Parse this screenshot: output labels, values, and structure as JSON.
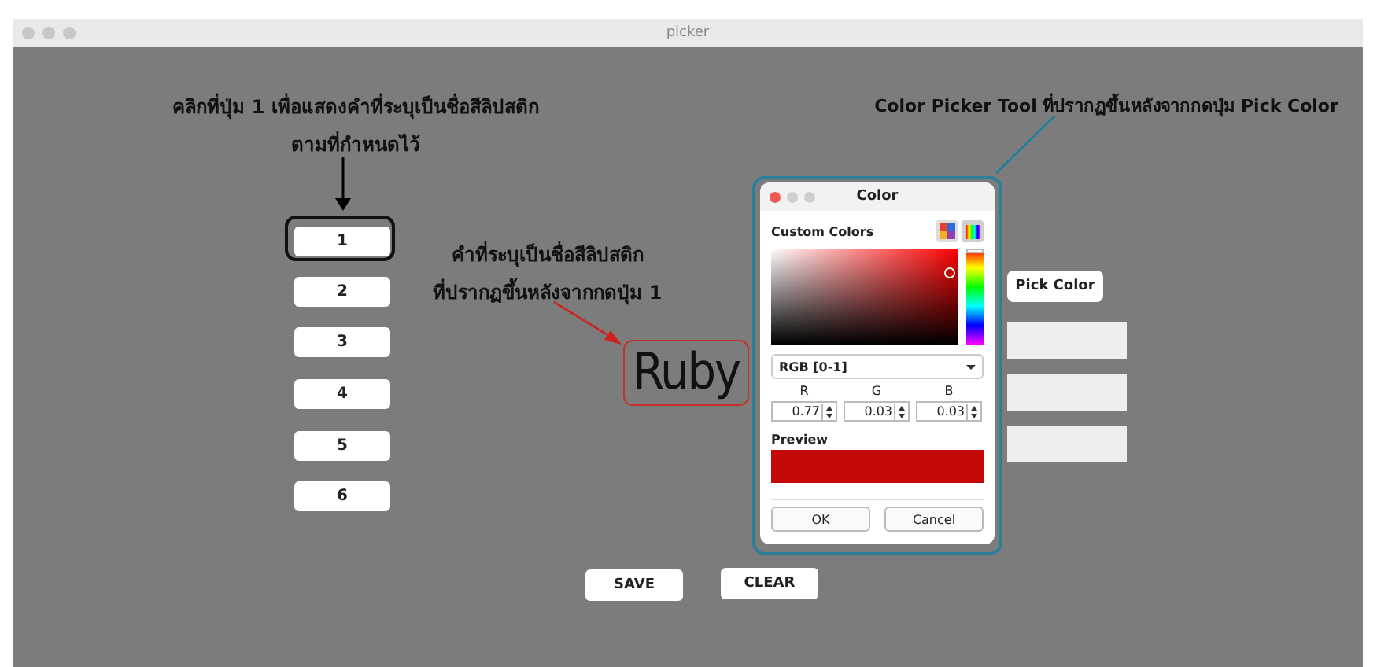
{
  "window": {
    "title": "picker"
  },
  "annotations": [
    {
      "lines": [
        "คลิกที่ปุ่ม 1 เพื่อแสดงคำที่ระบุเป็นชื่อสีลิปสติก",
        "ตามที่กำหนดไว้"
      ]
    },
    {
      "lines": [
        "คำที่ระบุเป็นชื่อสีลิปสติก",
        "ที่ปรากฏขึ้นหลังจากกดปุ่ม 1"
      ]
    },
    {
      "lines": [
        "Color Picker Tool ที่ปรากฏขึ้นหลังจากกดปุ่ม Pick Color"
      ]
    }
  ],
  "number_buttons": [
    {
      "label": "1",
      "selected": true
    },
    {
      "label": "2",
      "selected": false
    },
    {
      "label": "3",
      "selected": false
    },
    {
      "label": "4",
      "selected": false
    },
    {
      "label": "5",
      "selected": false
    },
    {
      "label": "6",
      "selected": false
    }
  ],
  "color_name": "Ruby",
  "pick_button": "Pick Color",
  "output_fields": [
    {
      "filled": false
    },
    {
      "filled": false
    },
    {
      "filled": false
    }
  ],
  "actions": [
    "SAVE",
    "CLEAR"
  ],
  "dialog": {
    "title": "Color",
    "section": "Custom Colors",
    "mode": "RGB [0-1]",
    "channels": [
      {
        "label": "R",
        "value": "0.77"
      },
      {
        "label": "G",
        "value": "0.03"
      },
      {
        "label": "B",
        "value": "0.03"
      }
    ],
    "hue_slider": {
      "level": 0
    },
    "preview_label": "Preview",
    "buttons": [
      "OK",
      "Cancel"
    ]
  }
}
